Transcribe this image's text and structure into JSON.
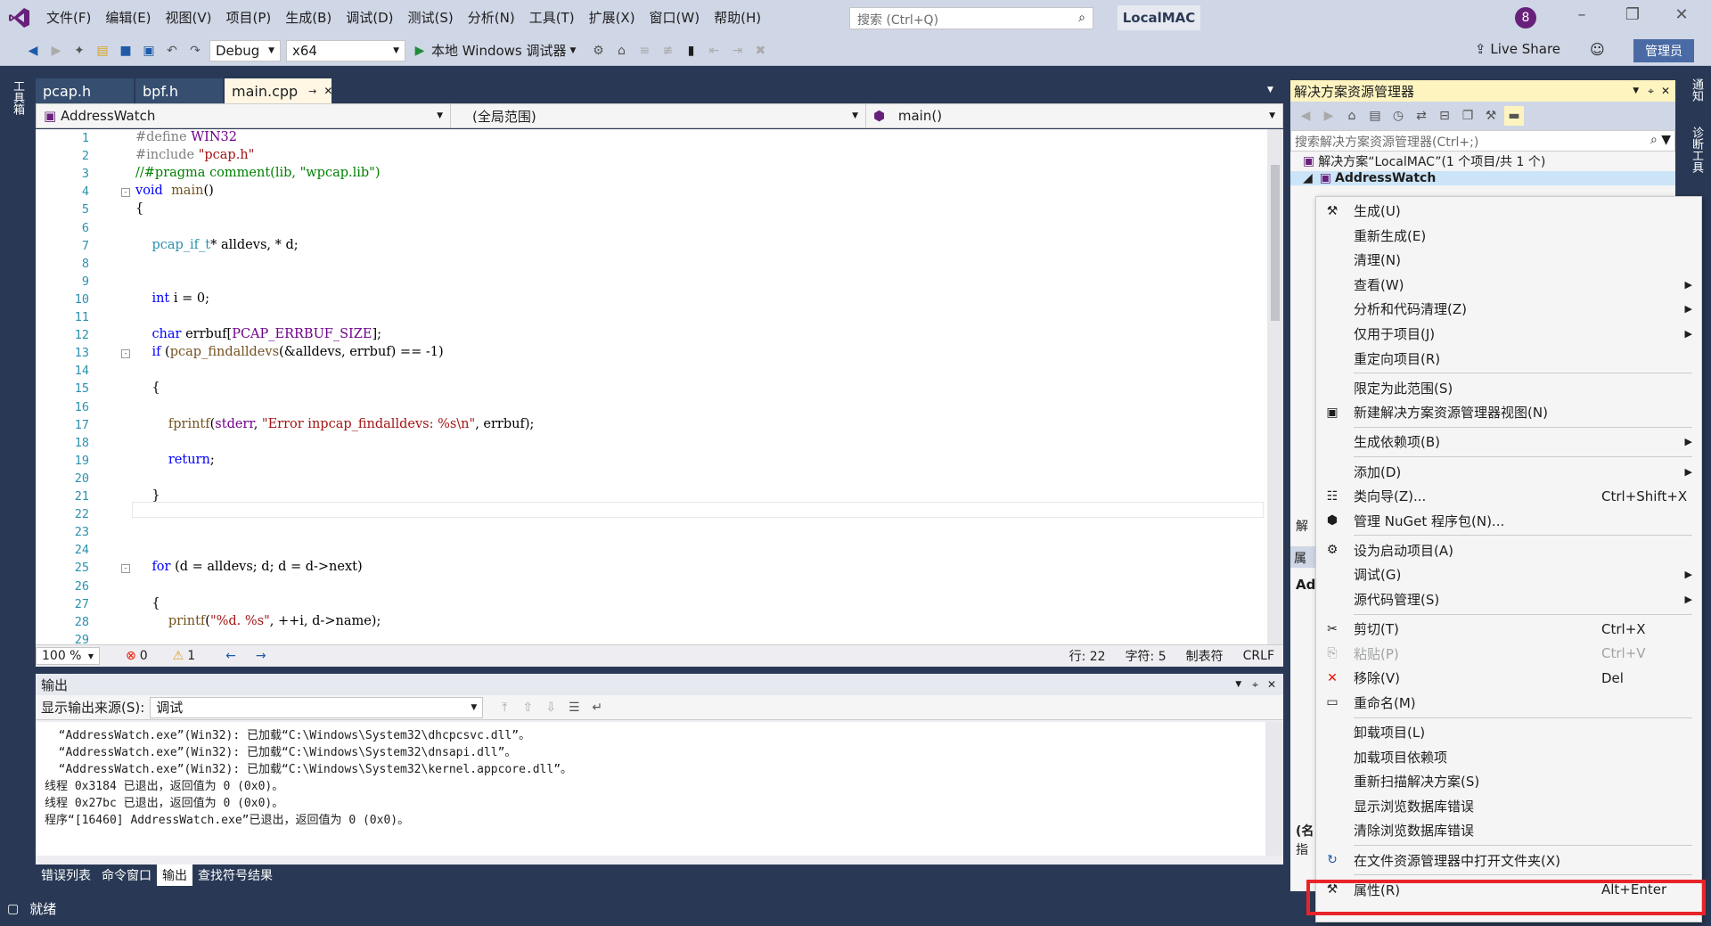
{
  "menubar": {
    "items": [
      "文件(F)",
      "编辑(E)",
      "视图(V)",
      "项目(P)",
      "生成(B)",
      "调试(D)",
      "测试(S)",
      "分析(N)",
      "工具(T)",
      "扩展(X)",
      "窗口(W)",
      "帮助(H)"
    ],
    "search_placeholder": "搜索 (Ctrl+Q)",
    "solution_name": "LocalMAC",
    "notification_count": "8"
  },
  "toolbar": {
    "config": "Debug",
    "platform": "x64",
    "run_label": "本地 Windows 调试器",
    "live_share": "Live Share",
    "admin": "管理员"
  },
  "left_strip": {
    "label": "工具箱"
  },
  "right_strip": {
    "labels": [
      "通知",
      "诊断工具"
    ]
  },
  "editor": {
    "tabs": [
      "pcap.h",
      "bpf.h",
      "main.cpp"
    ],
    "nav": {
      "project": "AddressWatch",
      "scope": "(全局范围)",
      "function": "main()"
    },
    "lines": [
      {
        "n": "1",
        "text": "#define WIN32"
      },
      {
        "n": "2",
        "text": "#include \"pcap.h\""
      },
      {
        "n": "3",
        "text": "//#pragma comment(lib, \"wpcap.lib\")"
      },
      {
        "n": "4",
        "text": "void  main()"
      },
      {
        "n": "5",
        "text": "{"
      },
      {
        "n": "6",
        "text": ""
      },
      {
        "n": "7",
        "text": "    pcap_if_t* alldevs, * d;"
      },
      {
        "n": "8",
        "text": ""
      },
      {
        "n": "9",
        "text": ""
      },
      {
        "n": "10",
        "text": "    int i = 0;"
      },
      {
        "n": "11",
        "text": ""
      },
      {
        "n": "12",
        "text": "    char errbuf[PCAP_ERRBUF_SIZE];"
      },
      {
        "n": "13",
        "text": "    if (pcap_findalldevs(&alldevs, errbuf) == -1)"
      },
      {
        "n": "14",
        "text": ""
      },
      {
        "n": "15",
        "text": "    {"
      },
      {
        "n": "16",
        "text": ""
      },
      {
        "n": "17",
        "text": "        fprintf(stderr, \"Error inpcap_findalldevs: %s\\n\", errbuf);"
      },
      {
        "n": "18",
        "text": ""
      },
      {
        "n": "19",
        "text": "        return;"
      },
      {
        "n": "20",
        "text": ""
      },
      {
        "n": "21",
        "text": "    }"
      },
      {
        "n": "22",
        "text": ""
      },
      {
        "n": "23",
        "text": ""
      },
      {
        "n": "24",
        "text": ""
      },
      {
        "n": "25",
        "text": "    for (d = alldevs; d; d = d->next)"
      },
      {
        "n": "26",
        "text": ""
      },
      {
        "n": "27",
        "text": "    {"
      },
      {
        "n": "28",
        "text": "        printf(\"%d. %s\", ++i, d->name);"
      },
      {
        "n": "29",
        "text": ""
      }
    ],
    "status": {
      "zoom": "100 %",
      "errors": "0",
      "warnings": "1",
      "line": "行: 22",
      "char": "字符: 5",
      "tabs": "制表符",
      "eol": "CRLF"
    }
  },
  "output": {
    "title": "输出",
    "source_label": "显示输出来源(S):",
    "source_value": "调试",
    "lines": [
      "  “AddressWatch.exe”(Win32): 已加载“C:\\Windows\\System32\\dhcpcsvc.dll”。",
      "  “AddressWatch.exe”(Win32): 已加载“C:\\Windows\\System32\\dnsapi.dll”。",
      "  “AddressWatch.exe”(Win32): 已加载“C:\\Windows\\System32\\kernel.appcore.dll”。",
      "线程 0x3184 已退出，返回值为 0 (0x0)。",
      "线程 0x27bc 已退出，返回值为 0 (0x0)。",
      "程序“[16460] AddressWatch.exe”已退出，返回值为 0 (0x0)。"
    ]
  },
  "bottom_tabs": [
    "错误列表",
    "命令窗口",
    "输出",
    "查找符号结果"
  ],
  "statusbar": {
    "text": "就绪"
  },
  "solution_explorer": {
    "title": "解决方案资源管理器",
    "search_placeholder": "搜索解决方案资源管理器(Ctrl+;)",
    "solution_node": "解决方案“LocalMAC”(1 个项目/共 1 个)",
    "project_node": "AddressWatch",
    "partial_labels": [
      "解",
      "属",
      "Ad",
      "(名",
      "指"
    ]
  },
  "context_menu": {
    "items": [
      {
        "label": "生成(U)",
        "icon": "build-icon"
      },
      {
        "label": "重新生成(E)"
      },
      {
        "label": "清理(N)"
      },
      {
        "label": "查看(W)",
        "submenu": true
      },
      {
        "label": "分析和代码清理(Z)",
        "submenu": true
      },
      {
        "label": "仅用于项目(J)",
        "submenu": true
      },
      {
        "label": "重定向项目(R)"
      },
      {
        "label": "限定为此范围(S)"
      },
      {
        "label": "新建解决方案资源管理器视图(N)",
        "icon": "new-view-icon"
      },
      {
        "label": "生成依赖项(B)",
        "submenu": true
      },
      {
        "label": "添加(D)",
        "submenu": true
      },
      {
        "label": "类向导(Z)...",
        "icon": "class-wizard-icon",
        "shortcut": "Ctrl+Shift+X"
      },
      {
        "label": "管理 NuGet 程序包(N)...",
        "icon": "nuget-icon"
      },
      {
        "label": "设为启动项目(A)",
        "icon": "gear-icon"
      },
      {
        "label": "调试(G)",
        "submenu": true
      },
      {
        "label": "源代码管理(S)",
        "submenu": true
      },
      {
        "label": "剪切(T)",
        "icon": "scissors-icon",
        "shortcut": "Ctrl+X"
      },
      {
        "label": "粘贴(P)",
        "icon": "paste-icon",
        "shortcut": "Ctrl+V",
        "disabled": true
      },
      {
        "label": "移除(V)",
        "icon": "remove-icon",
        "shortcut": "Del"
      },
      {
        "label": "重命名(M)",
        "icon": "rename-icon"
      },
      {
        "label": "卸载项目(L)"
      },
      {
        "label": "加载项目依赖项"
      },
      {
        "label": "重新扫描解决方案(S)"
      },
      {
        "label": "显示浏览数据库错误"
      },
      {
        "label": "清除浏览数据库错误"
      },
      {
        "label": "在文件资源管理器中打开文件夹(X)",
        "icon": "open-folder-icon"
      },
      {
        "label": "属性(R)",
        "icon": "wrench-icon",
        "shortcut": "Alt+Enter"
      }
    ]
  },
  "colors": {
    "accent": "#68217a",
    "frame": "#293955",
    "highlight": "#e8232a",
    "menu_bg": "#cfd6e5"
  }
}
